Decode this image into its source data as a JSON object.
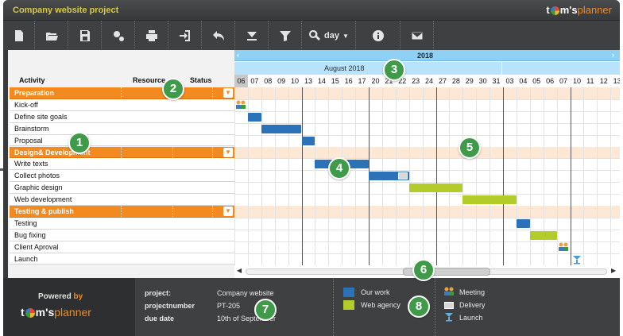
{
  "app": {
    "title": "Company website project",
    "logo_main": "t",
    "logo_mid": "m's",
    "logo_end": "planner"
  },
  "toolbar": {
    "zoom_label": "day",
    "icons": [
      "new-document-icon",
      "open-folder-icon",
      "save-icon",
      "settings-icon",
      "print-icon",
      "export-icon",
      "undo-icon",
      "collapse-icon",
      "filter-icon",
      "zoom-icon",
      "info-icon",
      "email-icon"
    ]
  },
  "columns": {
    "activity": "Activity",
    "resource": "Resource",
    "status": "Status"
  },
  "timeline": {
    "year": "2018",
    "month": "August 2018",
    "days": [
      "06",
      "07",
      "08",
      "09",
      "10",
      "13",
      "14",
      "15",
      "16",
      "17",
      "20",
      "21",
      "22",
      "23",
      "24",
      "27",
      "28",
      "29",
      "30",
      "31",
      "03",
      "04",
      "05",
      "06",
      "07",
      "10",
      "11",
      "12",
      "13"
    ]
  },
  "rows": [
    {
      "label": "Preparation",
      "group": true
    },
    {
      "label": "Kick-off",
      "group": false
    },
    {
      "label": "Define site goals",
      "group": false
    },
    {
      "label": "Brainstorm",
      "group": false
    },
    {
      "label": "Proposal",
      "group": false
    },
    {
      "label": "Design& Development",
      "group": true
    },
    {
      "label": "Write texts",
      "group": false
    },
    {
      "label": "Collect photos",
      "group": false
    },
    {
      "label": "Graphic design",
      "group": false
    },
    {
      "label": "Web development",
      "group": false
    },
    {
      "label": "Testing & publish",
      "group": true
    },
    {
      "label": "Testing",
      "group": false
    },
    {
      "label": "Bug fixing",
      "group": false
    },
    {
      "label": "Client Aproval",
      "group": false
    },
    {
      "label": "Launch",
      "group": false
    }
  ],
  "schedule": [
    {
      "row": 1,
      "type": "meeting",
      "start": 0
    },
    {
      "row": 2,
      "type": "blue",
      "start": 1,
      "end": 2
    },
    {
      "row": 3,
      "type": "blue",
      "start": 2,
      "end": 5
    },
    {
      "row": 4,
      "type": "blue",
      "start": 5,
      "end": 6
    },
    {
      "row": 6,
      "type": "blue",
      "start": 6,
      "end": 10
    },
    {
      "row": 7,
      "type": "blue",
      "start": 10,
      "end": 13,
      "delivery": true
    },
    {
      "row": 8,
      "type": "green",
      "start": 13,
      "end": 17
    },
    {
      "row": 9,
      "type": "green",
      "start": 17,
      "end": 21
    },
    {
      "row": 11,
      "type": "blue",
      "start": 21,
      "end": 22
    },
    {
      "row": 12,
      "type": "green",
      "start": 22,
      "end": 24
    },
    {
      "row": 13,
      "type": "meeting",
      "start": 24
    },
    {
      "row": 14,
      "type": "launch",
      "start": 25
    }
  ],
  "footer": {
    "powered": "Powered",
    "by": "by",
    "project_key": "project:",
    "project_value": "Company website",
    "number_key": "projectnumber",
    "number_value": "PT-205",
    "due_key": "due date",
    "due_value": "10th of September",
    "legend": [
      {
        "label": "Our work",
        "color": "#2b72b8"
      },
      {
        "label": "Web agency",
        "color": "#b3cc2a"
      }
    ],
    "icon_legend": [
      {
        "label": "Meeting",
        "icon": "meeting-icon"
      },
      {
        "label": "Delivery",
        "icon": "delivery-icon"
      },
      {
        "label": "Launch",
        "icon": "launch-icon"
      }
    ]
  },
  "callouts": [
    "1",
    "2",
    "3",
    "4",
    "5",
    "6",
    "7",
    "8"
  ],
  "colors": {
    "accent": "#f28a20",
    "badge": "#3f9a4a",
    "our_work": "#2b72b8",
    "web_agency": "#b3cc2a"
  }
}
